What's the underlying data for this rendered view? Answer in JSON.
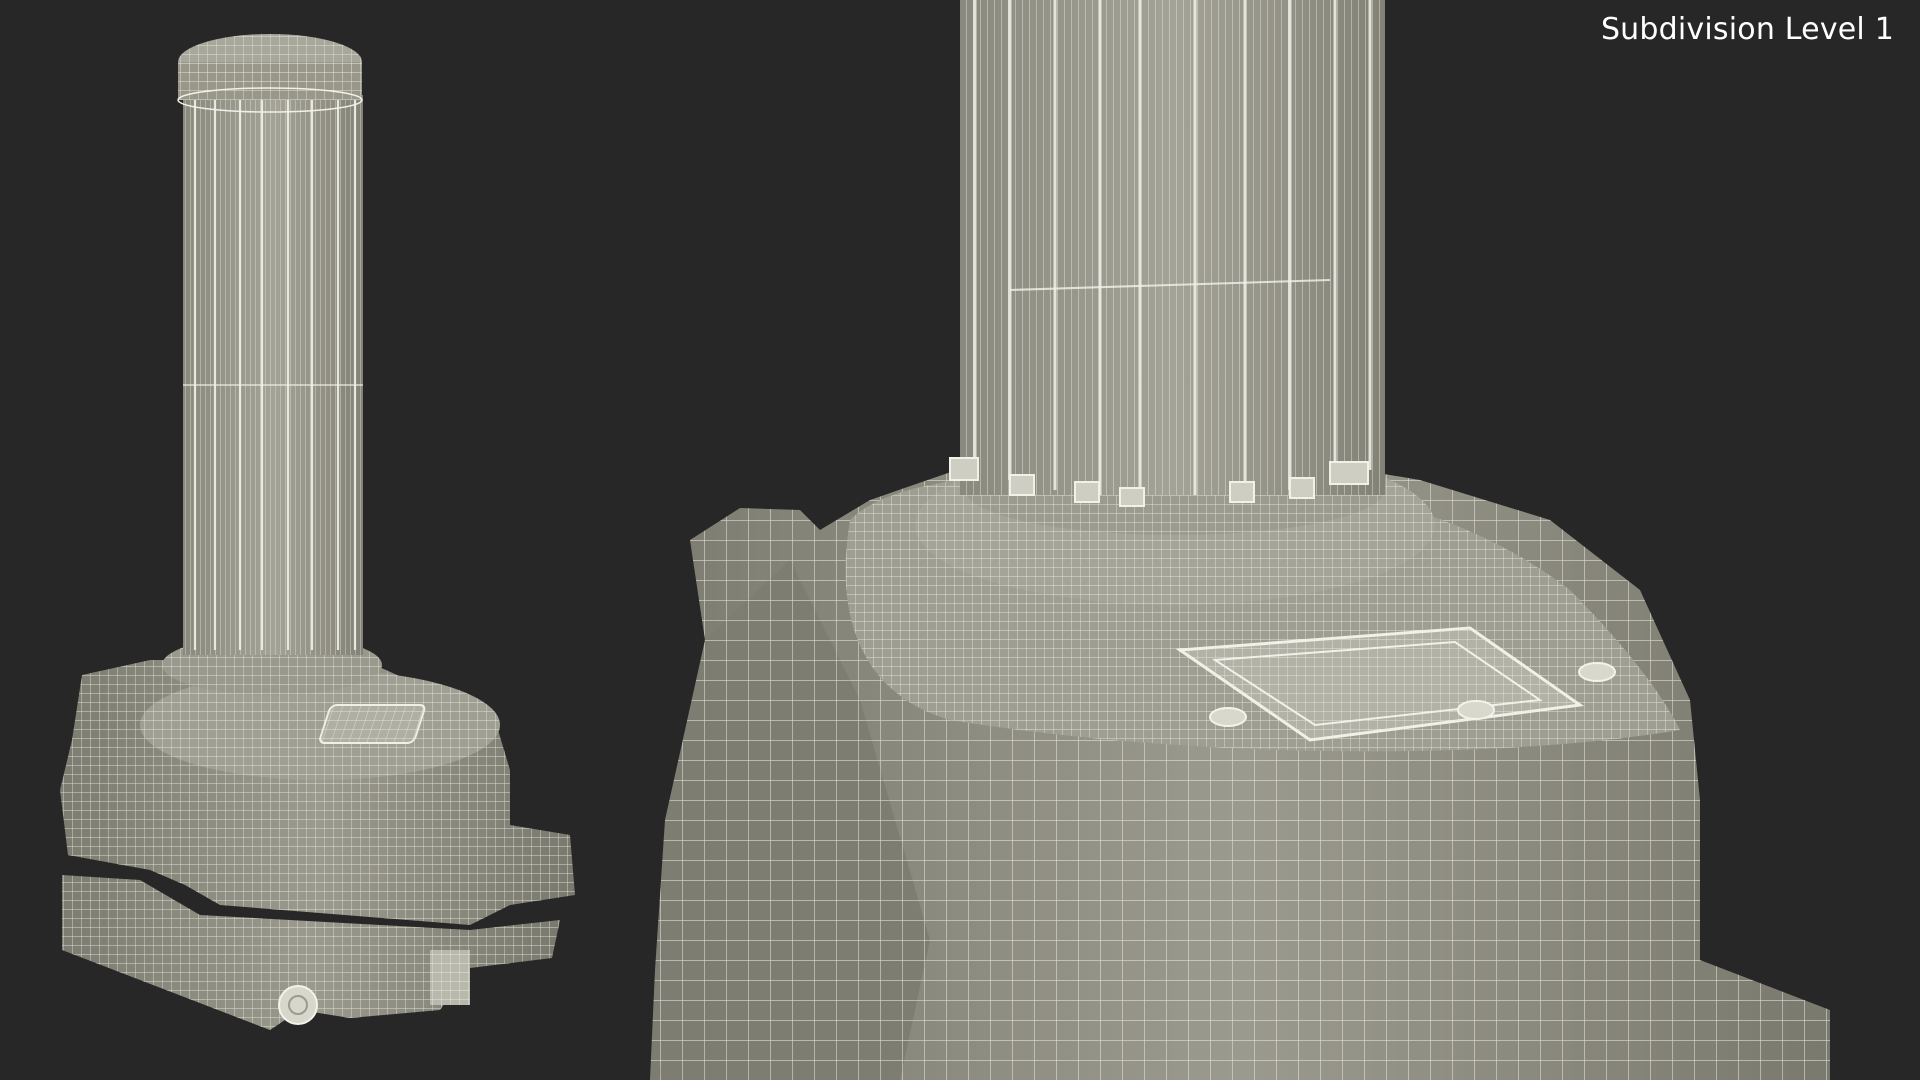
{
  "overlay": {
    "label": "Subdivision Level 1"
  },
  "colors": {
    "background": "#272727",
    "mesh_fill": "#8c8b7f",
    "mesh_fill_light": "#a6a598",
    "mesh_fill_dark": "#6f6e64",
    "wire": "#f2f1e8"
  },
  "scene": {
    "subject": "UV disinfection robot wireframe render",
    "views": [
      "full-view",
      "close-up-view"
    ]
  }
}
